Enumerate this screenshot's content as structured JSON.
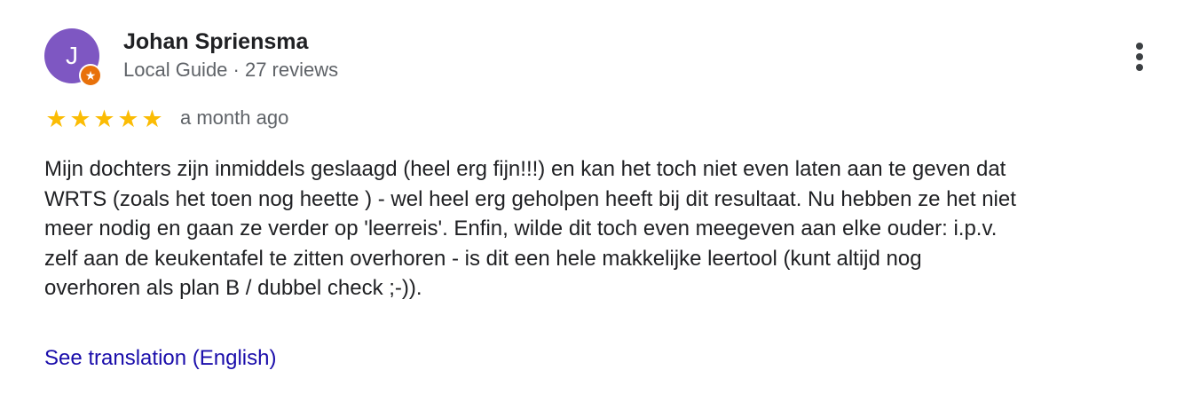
{
  "review": {
    "author": {
      "initial": "J",
      "name": "Johan Spriensma",
      "meta": "Local Guide · 27 reviews",
      "avatar_color": "#7e57c2",
      "badge_color": "#e8710a",
      "badge_icon": "star-icon"
    },
    "rating": 5,
    "rating_max": 5,
    "star_color": "#fbbc04",
    "time_ago": "a month ago",
    "text_lines": [
      "Mijn dochters zijn inmiddels geslaagd (heel erg fijn!!!) en kan het toch niet even laten aan te geven dat",
      "WRTS (zoals het toen nog heette ) - wel heel erg geholpen heeft bij dit resultaat. Nu hebben ze het niet",
      "meer nodig en gaan ze verder op 'leerreis'. Enfin, wilde dit toch even meegeven aan elke ouder: i.p.v.",
      "zelf aan de keukentafel te zitten overhoren - is dit een hele makkelijke leertool (kunt altijd nog",
      "overhoren als plan B / dubbel check ;-))."
    ],
    "translate_label": "See translation (English)",
    "link_color": "#1a0dab",
    "more_icon": "more-vert-icon"
  }
}
